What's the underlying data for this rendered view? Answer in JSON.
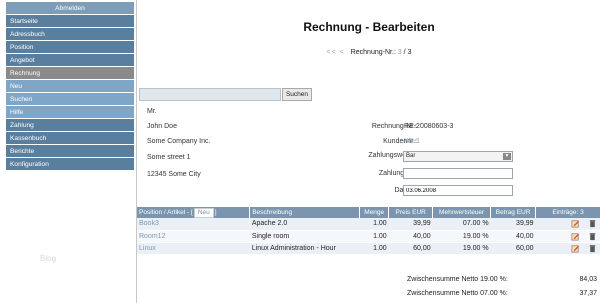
{
  "sidebar": {
    "logout": "Abmelden",
    "items": [
      {
        "label": "Startseite",
        "state": "normal"
      },
      {
        "label": "Adressbuch",
        "state": "normal"
      },
      {
        "label": "Position",
        "state": "normal"
      },
      {
        "label": "Angebot",
        "state": "normal"
      },
      {
        "label": "Rechnung",
        "state": "active"
      },
      {
        "label": "Neu",
        "state": "sub"
      },
      {
        "label": "Suchen",
        "state": "sub"
      },
      {
        "label": "Hilfe",
        "state": "sub"
      },
      {
        "label": "Zahlung",
        "state": "normal"
      },
      {
        "label": "Kassenbuch",
        "state": "normal"
      },
      {
        "label": "Berichte",
        "state": "normal"
      },
      {
        "label": "Konfiguration",
        "state": "normal"
      }
    ],
    "blog": "Blog"
  },
  "main": {
    "title": "Rechnung - Bearbeiten",
    "pager": {
      "arrows": "<< <",
      "label": "Rechnung-Nr.:",
      "current": "3",
      "sep": "/",
      "total": "3"
    },
    "search": {
      "value": "",
      "button": "Suchen"
    },
    "address": {
      "salutation": "Mr.",
      "name": "John Doe",
      "company": "Some Company Inc.",
      "street": "Some street 1",
      "city": "12345  Some City"
    },
    "fields": {
      "rechnung_nr_label": "Rechnung-Nr.:",
      "rechnung_nr_value": "RE-20080603-3",
      "kundennr_label": "Kundennr.:",
      "kundennr_value": "KD-1",
      "zahlungsweise_label": "Zahlungsweise:",
      "zahlungsweise_value": "Bar",
      "zahlung_bis_label": "Zahlung bis:",
      "zahlung_bis_value": "",
      "datum_label": "Datum:",
      "datum_value": "03.06.2008"
    },
    "table": {
      "col_position": "Position / Artikel - [",
      "new_label": "Neu",
      "col_position_close": "]",
      "col_beschreibung": "Beschreibung",
      "col_menge": "Menge",
      "col_preis": "Preis EUR",
      "col_mwst": "Mehrwertsteuer",
      "col_betrag": "Betrag EUR",
      "col_eintraege": "Einträge: 3",
      "rows": [
        {
          "position": "Book3",
          "beschreibung": "Apache 2.0",
          "menge": "1.00",
          "preis": "39,99",
          "mwst": "07.00 %",
          "betrag": "39,99"
        },
        {
          "position": "Room12",
          "beschreibung": "Single room",
          "menge": "1.00",
          "preis": "40,00",
          "mwst": "19.00 %",
          "betrag": "40,00"
        },
        {
          "position": "Linux",
          "beschreibung": "Linux Administration - Hour",
          "menge": "1.00",
          "preis": "60,00",
          "mwst": "19.00 %",
          "betrag": "60,00"
        }
      ]
    },
    "totals": [
      {
        "label": "Zwischensumme Netto 19.00 %:",
        "value": "84,03"
      },
      {
        "label": "Zwischensumme Netto 07.00 %:",
        "value": "37,37"
      }
    ]
  },
  "colors": {
    "nav": "#5a7f9e",
    "nav_active": "#8a8a8a",
    "nav_sub": "#7fa6c6",
    "table_header": "#7a95ad"
  }
}
